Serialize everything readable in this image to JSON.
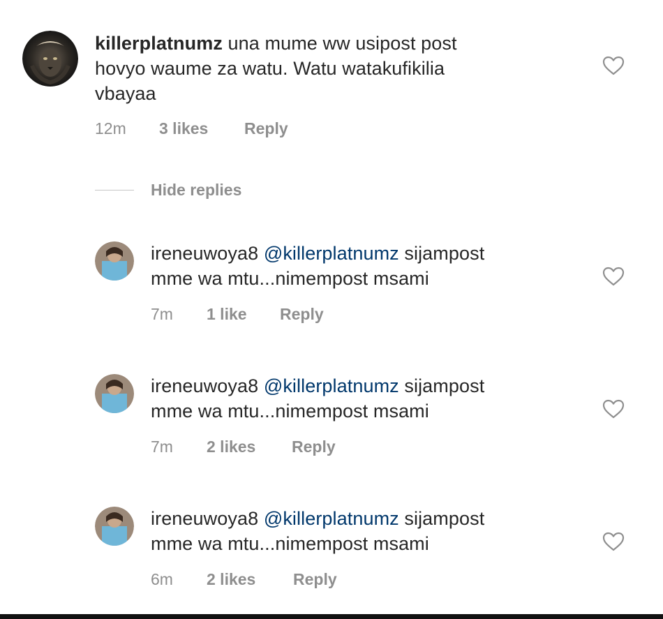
{
  "comment": {
    "username": "killerplatnumz",
    "text_line1": " una mume ww usipost post",
    "text_line2": "hovyo waume za watu.  Watu watakufikilia",
    "text_line3": "vbayaa",
    "time": "12m",
    "likes": "3 likes",
    "reply": "Reply",
    "avatar_icon": "lion-avatar-icon",
    "like_icon": "heart-outline-icon"
  },
  "hide_replies": {
    "label": "Hide replies"
  },
  "replies": [
    {
      "username": "ireneuwoya8",
      "mention": "@killerplatnumz",
      "text_line1_rest": " sijampost",
      "text_line2": "mme wa mtu...nimempost msami",
      "time": "7m",
      "likes": "1 like",
      "reply": "Reply"
    },
    {
      "username": "ireneuwoya8",
      "mention": "@killerplatnumz",
      "text_line1_rest": " sijampost",
      "text_line2": "mme wa mtu...nimempost msami",
      "time": "7m",
      "likes": "2 likes",
      "reply": "Reply"
    },
    {
      "username": "ireneuwoya8",
      "mention": "@killerplatnumz",
      "text_line1_rest": " sijampost",
      "text_line2": "mme wa mtu...nimempost msami",
      "time": "6m",
      "likes": "2 likes",
      "reply": "Reply"
    }
  ],
  "colors": {
    "text": "#262626",
    "secondary": "#8e8e8e",
    "mention": "#00376b",
    "background": "#ffffff"
  }
}
